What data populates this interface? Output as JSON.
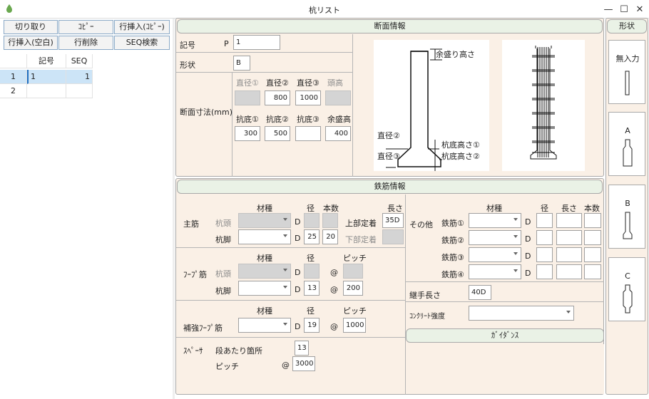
{
  "window": {
    "title": "杭リスト",
    "min": "—",
    "max": "☐",
    "close": "✕"
  },
  "toolbar": [
    {
      "label": "切り取り"
    },
    {
      "label": "ｺﾋﾟｰ"
    },
    {
      "label": "行挿入(ｺﾋﾟｰ)"
    },
    {
      "label": "行挿入(空白)"
    },
    {
      "label": "行削除"
    },
    {
      "label": "SEQ検索"
    }
  ],
  "grid": {
    "headers": {
      "kigou": "記号",
      "seq": "SEQ"
    },
    "rows": [
      {
        "num": "1",
        "kigou": "1",
        "seq": "1"
      },
      {
        "num": "2",
        "kigou": "",
        "seq": ""
      }
    ]
  },
  "section": {
    "header": "断面情報",
    "kigou_label": "記号",
    "kigou_prefix": "P",
    "kigou_value": "1",
    "shape_label": "形状",
    "shape_value": "B",
    "dims_label": "断面寸法(mm)",
    "cols1": [
      "直径①",
      "直径②",
      "直径③",
      "頭高"
    ],
    "vals1": [
      "",
      "800",
      "1000",
      ""
    ],
    "cols2": [
      "抗底①",
      "抗底②",
      "抗底③",
      "余盛高"
    ],
    "vals2": [
      "300",
      "500",
      "",
      "400"
    ],
    "diagram": {
      "extra": "余盛り高さ",
      "d2": "直径②",
      "d3": "直径③",
      "h1": "杭底高さ①",
      "h2": "杭底高さ②"
    }
  },
  "rebar": {
    "header": "鉄筋情報",
    "material": "材種",
    "diameter": "径",
    "count": "本数",
    "length": "長さ",
    "pitch": "ピッチ",
    "D": "D",
    "at": "@",
    "main": {
      "label": "主筋",
      "head": "杭頭",
      "foot": "杭脚",
      "foot_dia": "25",
      "foot_count": "20",
      "top_label": "上部定着",
      "top_value": "35D",
      "bottom_label": "下部定着"
    },
    "hoop": {
      "label": "ﾌｰﾌﾟ筋",
      "head": "杭頭",
      "foot": "杭脚",
      "foot_dia": "13",
      "foot_pitch": "200"
    },
    "reinf": {
      "label": "補強ﾌｰﾌﾟ筋",
      "dia": "19",
      "pitch": "1000"
    },
    "spacer": {
      "label": "ｽﾍﾟｰｻ",
      "per_stage": "段あたり箇所",
      "per_value": "13",
      "pitch_label": "ピッチ",
      "pitch_value": "3000"
    },
    "other": {
      "label": "その他",
      "items": [
        "鉄筋①",
        "鉄筋②",
        "鉄筋③",
        "鉄筋④"
      ]
    },
    "joint": {
      "label": "継手長さ",
      "value": "40D"
    },
    "concrete": {
      "label": "ｺﾝｸﾘｰﾄ強度"
    },
    "guidance": {
      "header": "ｶﾞｲﾀﾞﾝｽ"
    }
  },
  "shapes": {
    "header": "形状",
    "items": [
      {
        "label": "無入力"
      },
      {
        "label": "A"
      },
      {
        "label": "B"
      },
      {
        "label": "C"
      }
    ]
  }
}
